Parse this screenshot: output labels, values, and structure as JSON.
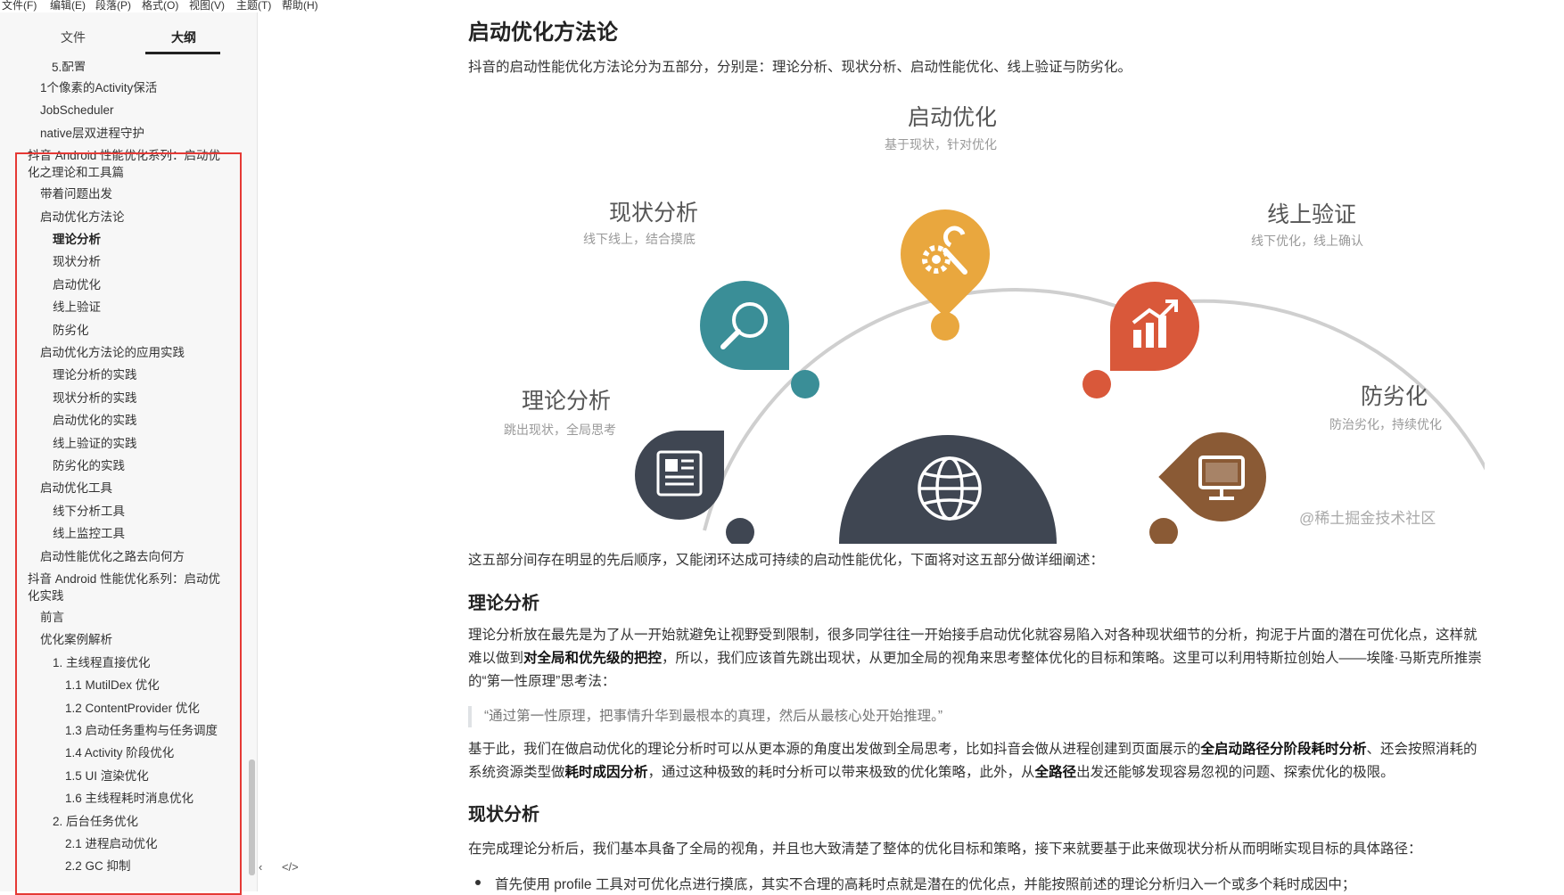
{
  "menu": [
    "文件(F)",
    "编辑(E)",
    "段落(P)",
    "格式(O)",
    "视图(V)",
    "主题(T)",
    "帮助(H)"
  ],
  "sidebar": {
    "tabs": {
      "files": "文件",
      "outline": "大纲"
    },
    "partial_top": "5.配置",
    "items": [
      {
        "label": "1个像素的Activity保活",
        "level": 1
      },
      {
        "label": "JobScheduler",
        "level": 1
      },
      {
        "label": "native层双进程守护",
        "level": 1
      },
      {
        "label": "抖音 Android 性能优化系列：启动优化之理论和工具篇",
        "level": 0
      },
      {
        "label": "带着问题出发",
        "level": 1
      },
      {
        "label": "启动优化方法论",
        "level": 1
      },
      {
        "label": "理论分析",
        "level": 2,
        "active": true
      },
      {
        "label": "现状分析",
        "level": 2
      },
      {
        "label": "启动优化",
        "level": 2
      },
      {
        "label": "线上验证",
        "level": 2
      },
      {
        "label": "防劣化",
        "level": 2
      },
      {
        "label": "启动优化方法论的应用实践",
        "level": 1
      },
      {
        "label": "理论分析的实践",
        "level": 2
      },
      {
        "label": "现状分析的实践",
        "level": 2
      },
      {
        "label": "启动优化的实践",
        "level": 2
      },
      {
        "label": "线上验证的实践",
        "level": 2
      },
      {
        "label": "防劣化的实践",
        "level": 2
      },
      {
        "label": "启动优化工具",
        "level": 1
      },
      {
        "label": "线下分析工具",
        "level": 2
      },
      {
        "label": "线上监控工具",
        "level": 2
      },
      {
        "label": "启动性能优化之路去向何方",
        "level": 1
      },
      {
        "label": "抖音 Android 性能优化系列：启动优化实践",
        "level": 0
      },
      {
        "label": "前言",
        "level": 1
      },
      {
        "label": "优化案例解析",
        "level": 1
      },
      {
        "label": "1. 主线程直接优化",
        "level": 2
      },
      {
        "label": "1.1 MutilDex 优化",
        "level": 3
      },
      {
        "label": "1.2 ContentProvider 优化",
        "level": 3
      },
      {
        "label": "1.3 启动任务重构与任务调度",
        "level": 3
      },
      {
        "label": "1.4 Activity 阶段优化",
        "level": 3
      },
      {
        "label": "1.5 UI 渲染优化",
        "level": 3
      },
      {
        "label": "1.6 主线程耗时消息优化",
        "level": 3
      },
      {
        "label": "2. 后台任务优化",
        "level": 2
      },
      {
        "label": "2.1 进程启动优化",
        "level": 3
      },
      {
        "label": "2.2 GC 抑制",
        "level": 3
      }
    ],
    "footer": [
      "‹",
      "</>"
    ]
  },
  "content": {
    "h1": "启动优化方法论",
    "intro": "抖音的启动性能优化方法论分为五部分，分别是：理论分析、现状分析、启动性能优化、线上验证与防劣化。",
    "diagram": {
      "nodes": [
        {
          "title": "启动优化",
          "subtitle": "基于现状，针对优化"
        },
        {
          "title": "现状分析",
          "subtitle": "线下线上，结合摸底"
        },
        {
          "title": "线上验证",
          "subtitle": "线下优化，线上确认"
        },
        {
          "title": "理论分析",
          "subtitle": "跳出现状，全局思考"
        },
        {
          "title": "防劣化",
          "subtitle": "防治劣化，持续优化"
        }
      ],
      "watermark": "@稀土掘金技术社区",
      "colors": {
        "teal": "#3a8e97",
        "orange": "#e9a73e",
        "red": "#d9583a",
        "dark": "#3f4652",
        "brown": "#8a5a35"
      }
    },
    "p_after_diagram": "这五部分间存在明显的先后顺序，又能闭环达成可持续的启动性能优化，下面将对这五部分做详细阐述：",
    "h2_theory": "理论分析",
    "theory_p1": {
      "a": "理论分析放在最先是为了从一开始就避免让视野受到限制，很多同学往往一开始接手启动优化就容易陷入对各种现状细节的分析，拘泥于片面的潜在可优化点，这样就难以做到",
      "b": "对全局和优先级的把控",
      "c": "，所以，我们应该首先跳出现状，从更加全局的视角来思考整体优化的目标和策略。这里可以利用特斯拉创始人——埃隆·马斯克所推崇的“第一性原理”思考法："
    },
    "quote": "“通过第一性原理，把事情升华到最根本的真理，然后从最核心处开始推理。”",
    "theory_p2": {
      "a": "基于此，我们在做启动优化的理论分析时可以从更本源的角度出发做到全局思考，比如抖音会做从进程创建到页面展示的",
      "b": "全启动路径分阶段耗时分析",
      "c": "、还会按照消耗的系统资源类型做",
      "d": "耗时成因分析",
      "e": "，通过这种极致的耗时分析可以带来极致的优化策略，此外，从",
      "f": "全路径",
      "g": "出发还能够发现容易忽视的问题、探索优化的极限。"
    },
    "h2_status": "现状分析",
    "status_p1": "在完成理论分析后，我们基本具备了全局的视角，并且也大致清楚了整体的优化目标和策略，接下来就要基于此来做现状分析从而明晰实现目标的具体路径：",
    "status_bullet": "首先使用 profile 工具对可优化点进行摸底，其实不合理的高耗时点就是潜在的优化点，并能按照前述的理论分析归入一个或多个耗时成因中；"
  }
}
